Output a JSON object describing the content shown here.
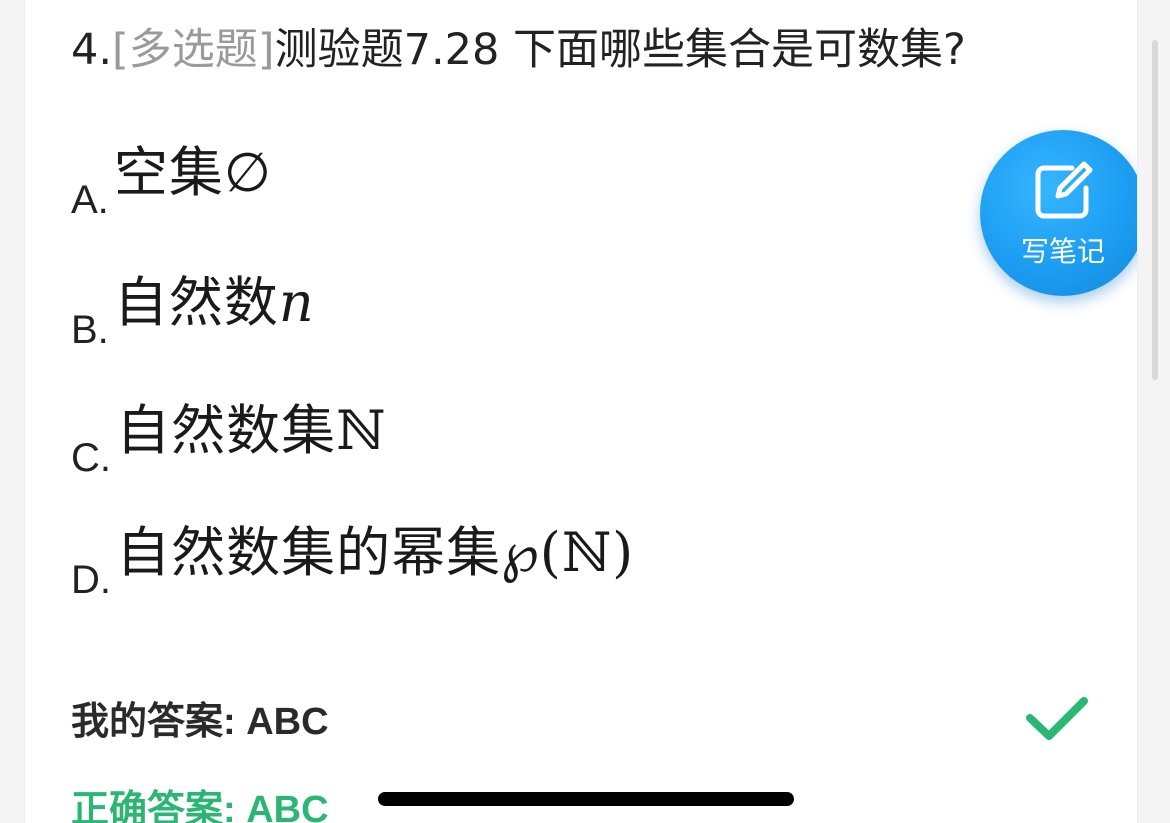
{
  "question": {
    "number": "4.",
    "tag": "[多选题]",
    "text": "测验题7.28 下面哪些集合是可数集?"
  },
  "options": [
    {
      "letter": "A.",
      "text": "空集",
      "symbol": "∅"
    },
    {
      "letter": "B.",
      "text": "自然数",
      "symbol": "n"
    },
    {
      "letter": "C.",
      "text": "自然数集",
      "symbol": "ℕ"
    },
    {
      "letter": "D.",
      "text": "自然数集的幂集",
      "symbol": "℘(ℕ)"
    }
  ],
  "my_answer": {
    "label": "我的答案:",
    "value": "ABC"
  },
  "correct_answer": {
    "label": "正确答案:",
    "value": "ABC"
  },
  "note_button": {
    "label": "写笔记",
    "icon": "edit-note-icon"
  },
  "icons": {
    "result": "check-icon"
  },
  "colors": {
    "correct_green": "#2bb673",
    "fab_blue": "#1a9bf0",
    "tag_gray": "#9a9a9a"
  }
}
